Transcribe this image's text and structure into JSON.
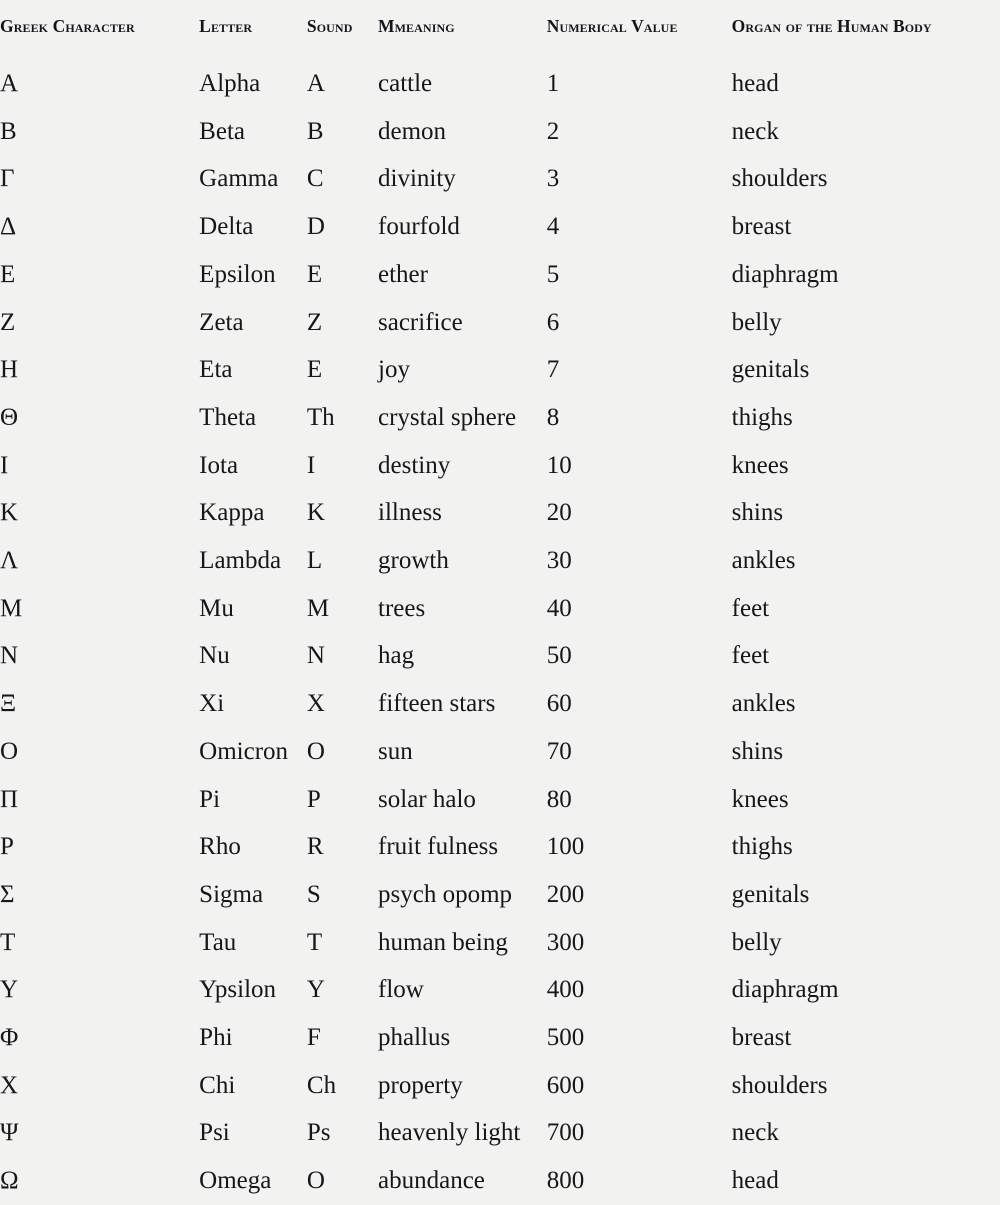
{
  "page": {
    "background_color": "#f2f2f0",
    "text_color": "#16161c"
  },
  "table": {
    "columns": [
      {
        "key": "character",
        "label": "Greek Character"
      },
      {
        "key": "letter",
        "label": "Letter"
      },
      {
        "key": "sound",
        "label": "Sound"
      },
      {
        "key": "meaning",
        "label": "Mmeaning"
      },
      {
        "key": "numeric",
        "label": "Numerical Value"
      },
      {
        "key": "organ",
        "label": "Organ of the Human Body"
      }
    ],
    "rows": [
      {
        "character": "Α",
        "letter": "Alpha",
        "sound": "A",
        "meaning": "cattle",
        "numeric": "1",
        "organ": "head"
      },
      {
        "character": "Β",
        "letter": "Beta",
        "sound": "B",
        "meaning": "demon",
        "numeric": "2",
        "organ": "neck"
      },
      {
        "character": "Γ",
        "letter": "Gamma",
        "sound": "C",
        "meaning": "divinity",
        "numeric": "3",
        "organ": "shoulders"
      },
      {
        "character": "Δ",
        "letter": "Delta",
        "sound": "D",
        "meaning": "fourfold",
        "numeric": "4",
        "organ": "breast"
      },
      {
        "character": "Ε",
        "letter": "Epsilon",
        "sound": "E",
        "meaning": "ether",
        "numeric": "5",
        "organ": "diaphragm"
      },
      {
        "character": "Ζ",
        "letter": "Zeta",
        "sound": "Z",
        "meaning": "sacrifice",
        "numeric": "6",
        "organ": "belly"
      },
      {
        "character": "Η",
        "letter": "Eta",
        "sound": "E",
        "meaning": "joy",
        "numeric": "7",
        "organ": "genitals"
      },
      {
        "character": "Θ",
        "letter": "Theta",
        "sound": "Th",
        "meaning": "crystal sphere",
        "numeric": "8",
        "organ": "thighs"
      },
      {
        "character": "Ι",
        "letter": "Iota",
        "sound": "I",
        "meaning": "destiny",
        "numeric": "10",
        "organ": "knees"
      },
      {
        "character": "Κ",
        "letter": "Kappa",
        "sound": "K",
        "meaning": "illness",
        "numeric": "20",
        "organ": "shins"
      },
      {
        "character": "Λ",
        "letter": "Lambda",
        "sound": "L",
        "meaning": "growth",
        "numeric": "30",
        "organ": "ankles"
      },
      {
        "character": "Μ",
        "letter": "Mu",
        "sound": "M",
        "meaning": "trees",
        "numeric": "40",
        "organ": "feet"
      },
      {
        "character": "Ν",
        "letter": "Nu",
        "sound": "N",
        "meaning": "hag",
        "numeric": "50",
        "organ": "feet"
      },
      {
        "character": "Ξ",
        "letter": "Xi",
        "sound": "X",
        "meaning": "fifteen stars",
        "numeric": "60",
        "organ": "ankles"
      },
      {
        "character": "Ο",
        "letter": "Omicron",
        "sound": "O",
        "meaning": "sun",
        "numeric": "70",
        "organ": "shins"
      },
      {
        "character": "Π",
        "letter": "Pi",
        "sound": "P",
        "meaning": "solar halo",
        "numeric": "80",
        "organ": "knees"
      },
      {
        "character": "Ρ",
        "letter": "Rho",
        "sound": "R",
        "meaning": "fruit fulness",
        "numeric": "100",
        "organ": "thighs"
      },
      {
        "character": "Σ",
        "letter": "Sigma",
        "sound": "S",
        "meaning": "psych opomp",
        "numeric": "200",
        "organ": "genitals"
      },
      {
        "character": "Τ",
        "letter": "Tau",
        "sound": "T",
        "meaning": "human being",
        "numeric": "300",
        "organ": "belly"
      },
      {
        "character": "Υ",
        "letter": "Ypsilon",
        "sound": "Y",
        "meaning": "flow",
        "numeric": "400",
        "organ": "diaphragm"
      },
      {
        "character": "Φ",
        "letter": "Phi",
        "sound": "F",
        "meaning": "phallus",
        "numeric": "500",
        "organ": "breast"
      },
      {
        "character": "Χ",
        "letter": "Chi",
        "sound": "Ch",
        "meaning": "property",
        "numeric": "600",
        "organ": "shoulders"
      },
      {
        "character": "Ψ",
        "letter": "Psi",
        "sound": "Ps",
        "meaning": "heavenly light",
        "numeric": "700",
        "organ": "neck"
      },
      {
        "character": "Ω",
        "letter": "Omega",
        "sound": "O",
        "meaning": "abundance",
        "numeric": "800",
        "organ": "head"
      }
    ]
  }
}
